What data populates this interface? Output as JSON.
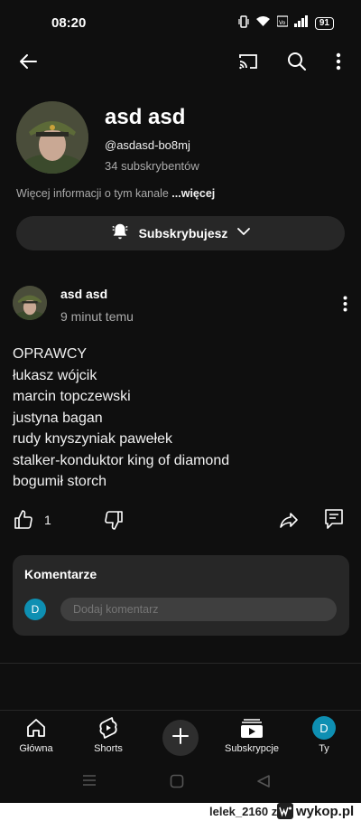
{
  "status_bar": {
    "time": "08:20",
    "battery": "91"
  },
  "channel": {
    "name": "asd asd",
    "handle": "@asdasd-bo8mj",
    "subscribers": "34 subskrybentów",
    "more_info": "Więcej informacji o tym kanale",
    "more_link": "...więcej",
    "subscribe_label": "Subskrybujesz"
  },
  "post": {
    "author": "asd asd",
    "time": "9 minut temu",
    "lines": [
      "OPRAWCY",
      "łukasz wójcik",
      "marcin topczewski",
      "justyna bagan",
      "rudy knyszyniak pawełek",
      "stalker-konduktor king of diamond",
      "bogumił storch"
    ],
    "likes": "1"
  },
  "comments": {
    "title": "Komentarze",
    "avatar_letter": "D",
    "placeholder": "Dodaj komentarz"
  },
  "bottom_nav": {
    "items": [
      {
        "label": "Główna",
        "icon": "home-icon"
      },
      {
        "label": "Shorts",
        "icon": "shorts-icon"
      },
      {
        "label": "Subskrypcje",
        "icon": "subscriptions-icon"
      },
      {
        "label": "Ty",
        "icon": "profile-avatar"
      }
    ],
    "avatar_letter": "D"
  },
  "footer": {
    "user": "lelek_2160",
    "separator": "z",
    "site": "wykop.pl"
  },
  "colors": {
    "background": "#0f0f0f",
    "surface": "#272727",
    "accent_avatar": "#0e8fb2",
    "secondary_text": "#aaaaaa"
  }
}
